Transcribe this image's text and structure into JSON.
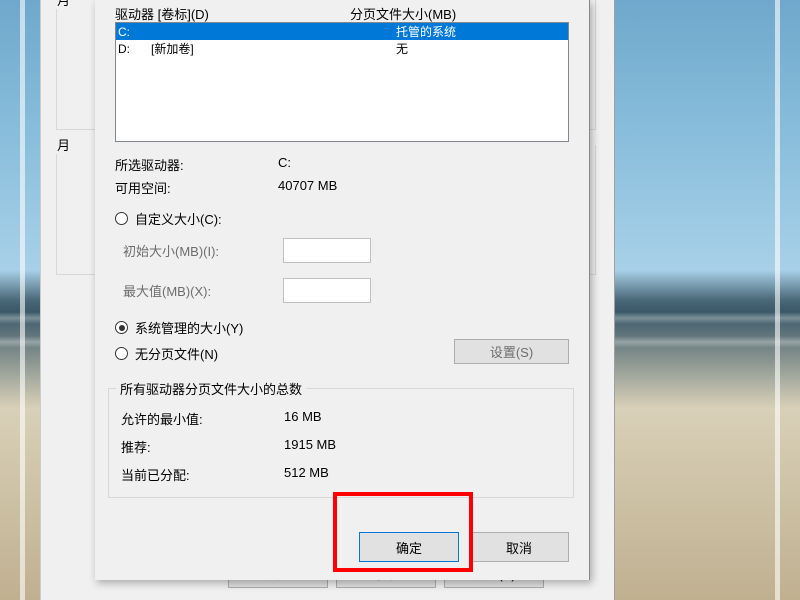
{
  "headers": {
    "drive": "驱动器  [卷标](D)",
    "paging": "分页文件大小(MB)"
  },
  "drives": [
    {
      "letter": "C:",
      "label": "",
      "paging": "托管的系统",
      "selected": true
    },
    {
      "letter": "D:",
      "label": "[新加卷]",
      "paging": "无",
      "selected": false
    }
  ],
  "selected": {
    "label": "所选驱动器:",
    "value": "C:"
  },
  "available": {
    "label": "可用空间:",
    "value": "40707 MB"
  },
  "radio": {
    "custom": "自定义大小(C):",
    "system": "系统管理的大小(Y)",
    "none": "无分页文件(N)"
  },
  "size": {
    "initial_label": "初始大小(MB)(I):",
    "max_label": "最大值(MB)(X):"
  },
  "set_button": "设置(S)",
  "totals": {
    "group_label": "所有驱动器分页文件大小的总数",
    "min": {
      "label": "允许的最小值:",
      "value": "16 MB"
    },
    "rec": {
      "label": "推荐:",
      "value": "1915 MB"
    },
    "cur": {
      "label": "当前已分配:",
      "value": "512 MB"
    }
  },
  "buttons": {
    "ok": "确定",
    "cancel": "取消",
    "apply": "应用(A)"
  },
  "parent": {
    "group1": "月",
    "group2": "月"
  }
}
